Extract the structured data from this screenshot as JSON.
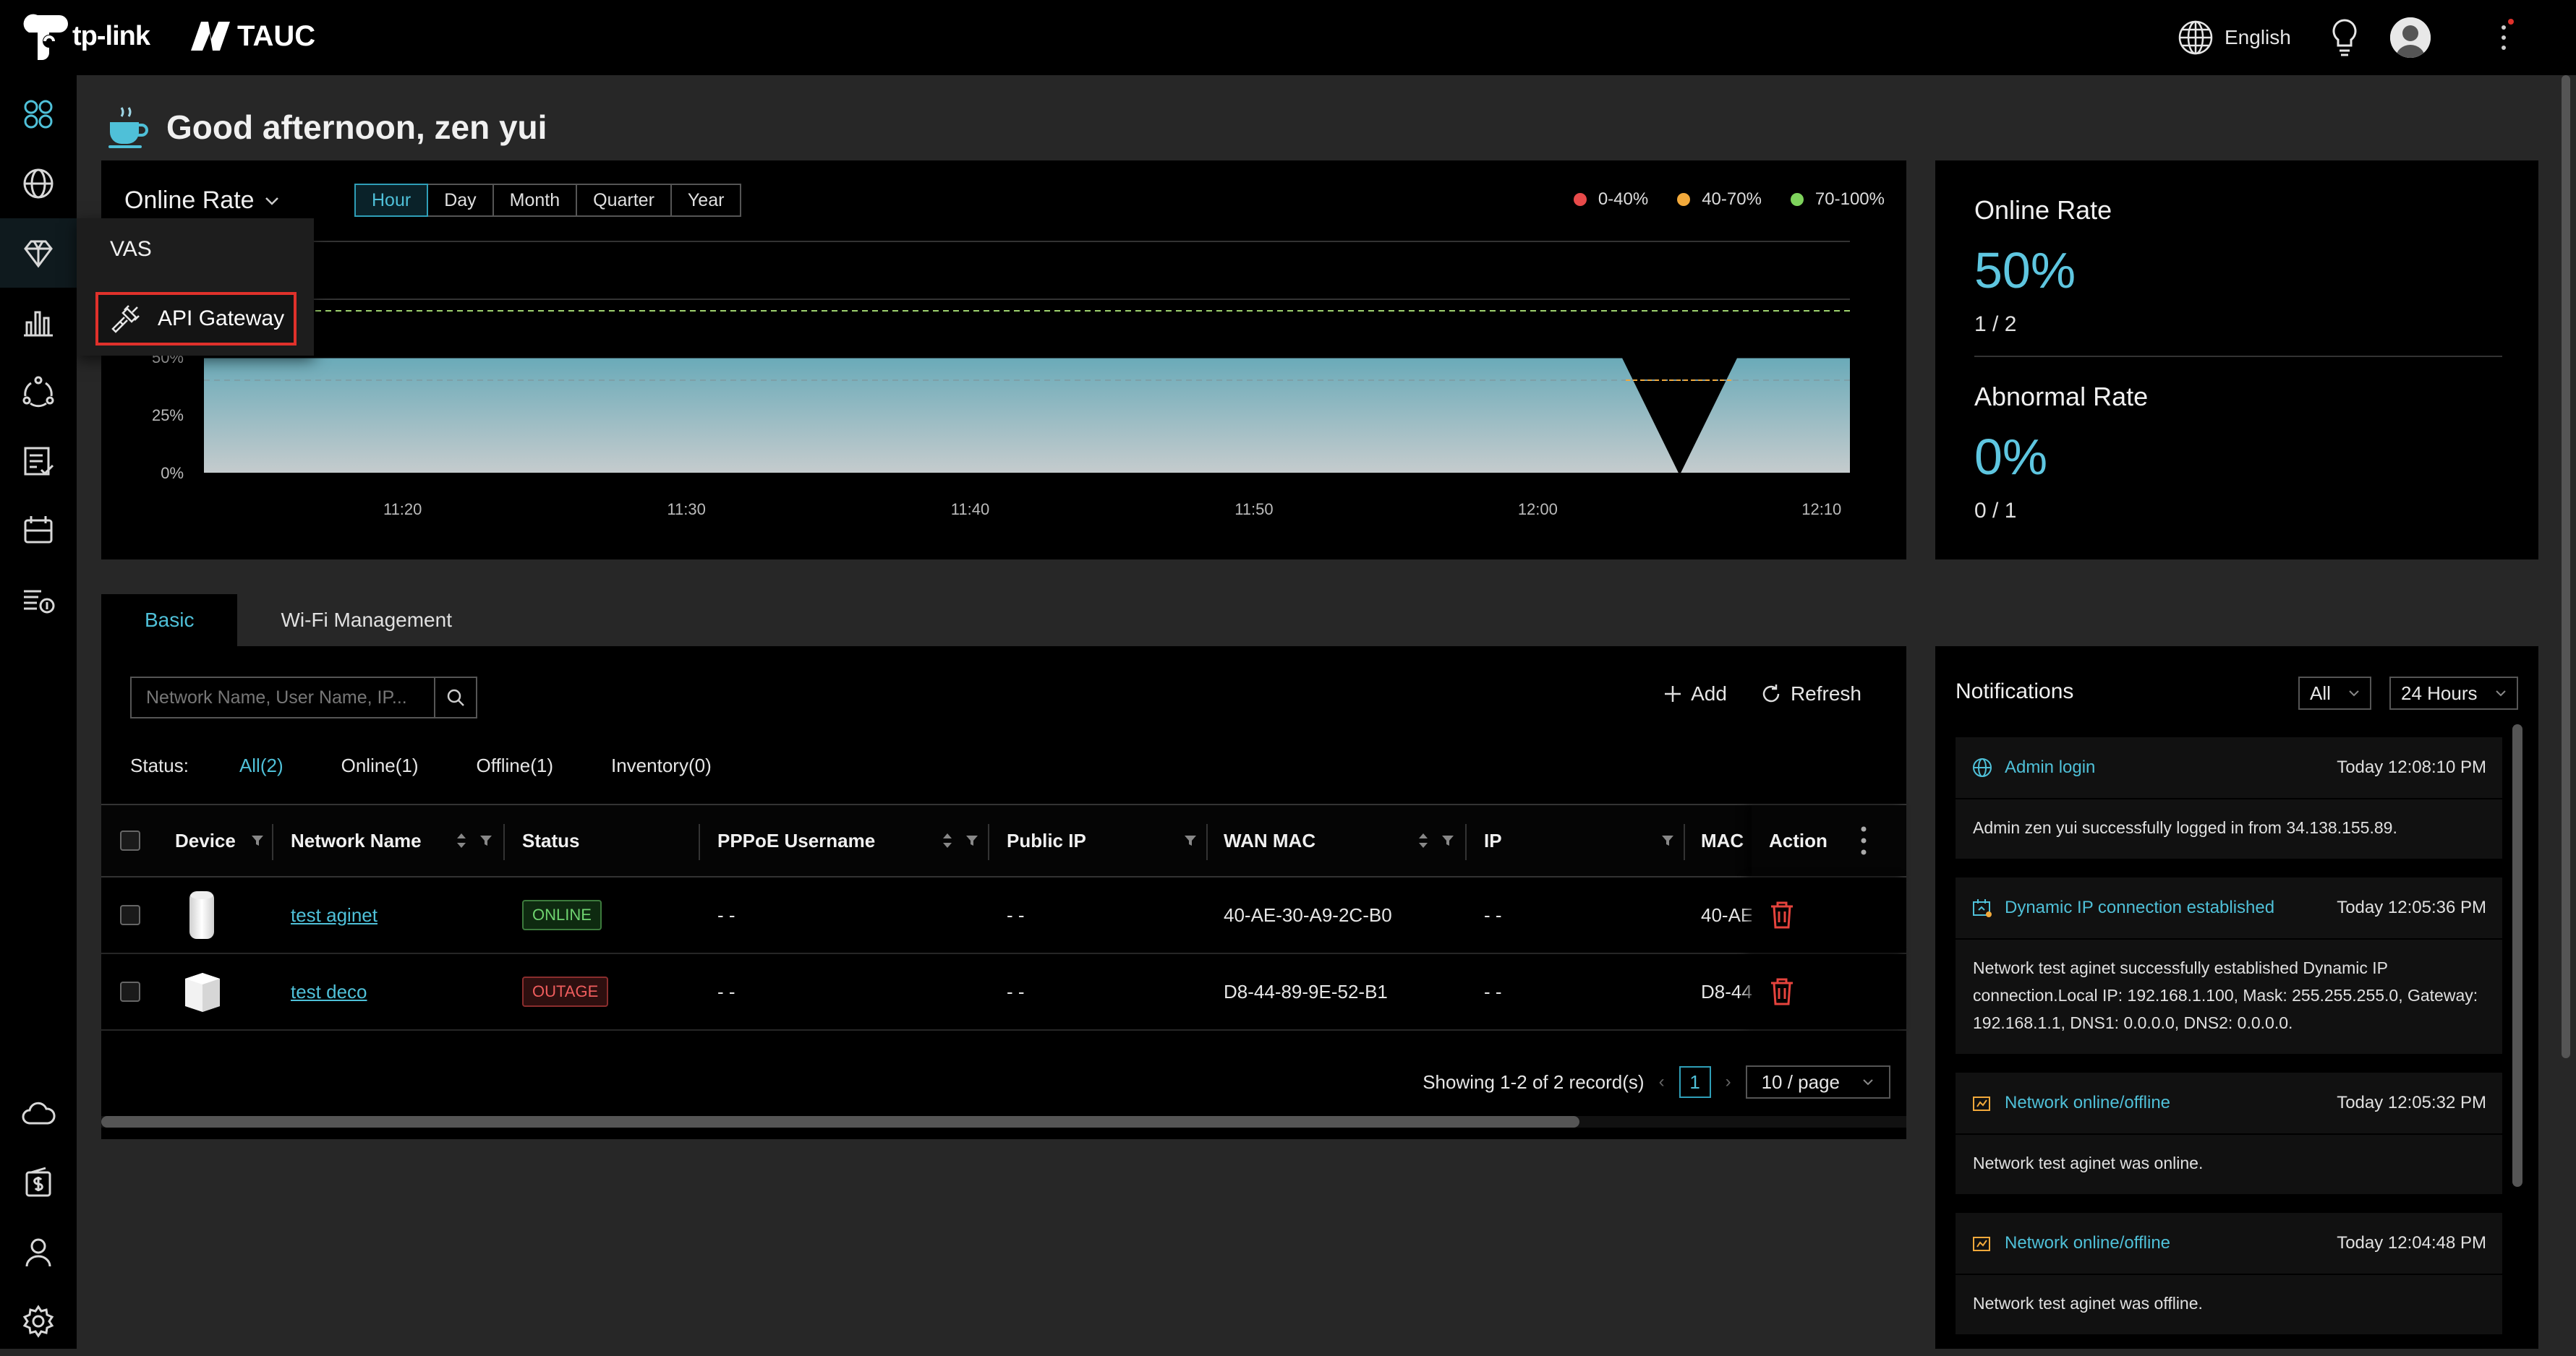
{
  "header": {
    "brand": "tp-link",
    "product": "TAUC",
    "language": "English"
  },
  "sidebar": {
    "items": [
      {
        "name": "dashboard",
        "icon": "dashboard-icon"
      },
      {
        "name": "network",
        "icon": "globe-icon"
      },
      {
        "name": "vas",
        "icon": "diamond-icon"
      },
      {
        "name": "statistics",
        "icon": "bar-chart-icon"
      },
      {
        "name": "topology",
        "icon": "network-nodes-icon"
      },
      {
        "name": "tasks",
        "icon": "checklist-icon"
      },
      {
        "name": "schedule",
        "icon": "calendar-icon"
      },
      {
        "name": "billing",
        "icon": "list-coin-icon"
      },
      {
        "name": "cloud",
        "icon": "cloud-icon"
      },
      {
        "name": "payment",
        "icon": "wallet-dollar-icon"
      },
      {
        "name": "account",
        "icon": "user-icon"
      },
      {
        "name": "settings",
        "icon": "gear-icon"
      }
    ]
  },
  "vas_menu": {
    "title": "VAS",
    "item": "API Gateway"
  },
  "greeting": "Good afternoon, zen yui",
  "chart_panel": {
    "metric": "Online Rate",
    "periods": [
      "Hour",
      "Day",
      "Month",
      "Quarter",
      "Year"
    ],
    "selected_period": "Hour",
    "legend": [
      {
        "label": "0-40%",
        "color": "#e84a4a"
      },
      {
        "label": "40-70%",
        "color": "#f2a93b"
      },
      {
        "label": "70-100%",
        "color": "#7ed35c"
      }
    ]
  },
  "chart_data": {
    "type": "area",
    "y_ticks": [
      "50%",
      "25%",
      "0%"
    ],
    "x_ticks": [
      "11:20",
      "11:30",
      "11:40",
      "11:50",
      "12:00",
      "12:10"
    ],
    "ylim": [
      0,
      100
    ],
    "x": [
      "11:13",
      "12:03",
      "12:05",
      "12:07",
      "12:11"
    ],
    "values": [
      50,
      50,
      0,
      50,
      50
    ],
    "threshold_lines": [
      70,
      40
    ],
    "fill_color": "#6fb3c2"
  },
  "stats": {
    "online_label": "Online Rate",
    "online_value": "50%",
    "online_sub": "1 / 2",
    "abnormal_label": "Abnormal Rate",
    "abnormal_value": "0%",
    "abnormal_sub": "0 / 1"
  },
  "tabs": [
    "Basic",
    "Wi-Fi Management"
  ],
  "table_panel": {
    "search_placeholder": "Network Name, User Name, IP...",
    "add_label": "Add",
    "refresh_label": "Refresh",
    "status_label": "Status:",
    "status_filters": [
      "All(2)",
      "Online(1)",
      "Offline(1)",
      "Inventory(0)"
    ],
    "columns": [
      "Device",
      "Network Name",
      "Status",
      "PPPoE Username",
      "Public IP",
      "WAN MAC",
      "IP",
      "MAC",
      "Action"
    ],
    "rows": [
      {
        "network": "test aginet",
        "status": "ONLINE",
        "pppoe": "- -",
        "public_ip": "- -",
        "wan_mac": "40-AE-30-A9-2C-B0",
        "ip": "- -",
        "mac": "40-AE"
      },
      {
        "network": "test deco",
        "status": "OUTAGE",
        "pppoe": "- -",
        "public_ip": "- -",
        "wan_mac": "D8-44-89-9E-52-B1",
        "ip": "- -",
        "mac": "D8-44"
      }
    ],
    "pagination": {
      "summary": "Showing 1-2 of 2 record(s)",
      "page": "1",
      "page_size": "10 / page"
    }
  },
  "notifications": {
    "title": "Notifications",
    "filter_type": "All",
    "filter_range": "24 Hours",
    "items": [
      {
        "icon": "globe-icon",
        "title": "Admin login",
        "time": "Today 12:08:10 PM",
        "body": "Admin zen yui successfully logged in from 34.138.155.89."
      },
      {
        "icon": "connection-icon",
        "title": "Dynamic IP connection established",
        "time": "Today 12:05:36 PM",
        "body": "Network test aginet successfully established Dynamic IP connection.Local IP: 192.168.1.100, Mask: 255.255.255.0, Gateway: 192.168.1.1, DNS1: 0.0.0.0, DNS2: 0.0.0.0."
      },
      {
        "icon": "network-status-icon",
        "title": "Network online/offline",
        "time": "Today 12:05:32 PM",
        "body": "Network test aginet was online."
      },
      {
        "icon": "network-status-icon",
        "title": "Network online/offline",
        "time": "Today 12:04:48 PM",
        "body": "Network test aginet was offline."
      }
    ]
  }
}
